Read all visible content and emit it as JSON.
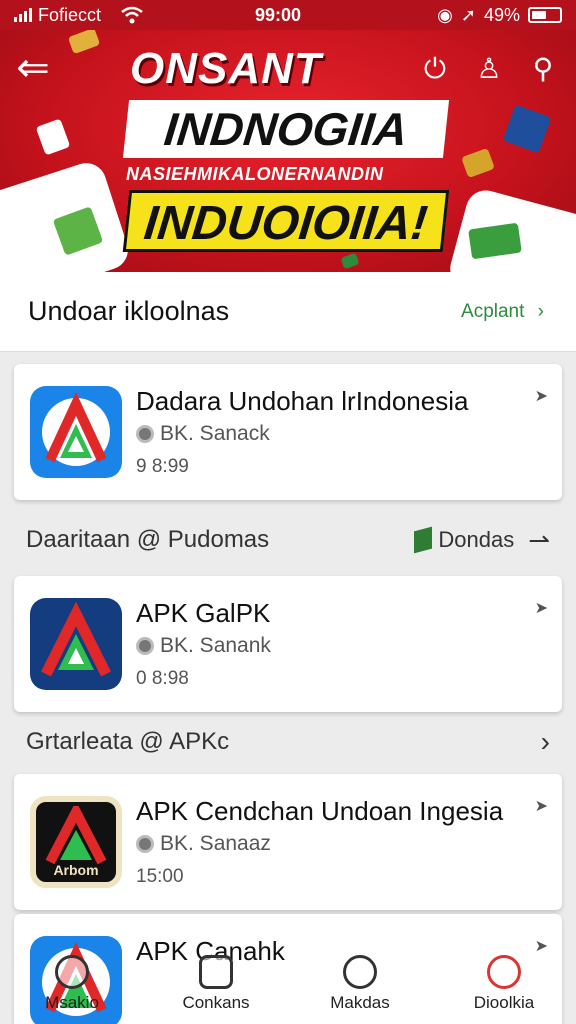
{
  "status_bar": {
    "carrier": "Fofiecct",
    "time": "99:00",
    "battery": "49%"
  },
  "banner": {
    "title": "ONSANT",
    "heading": "INDNOGIIA",
    "subtitle": "NASIEHMIKALONERNANDIN",
    "highlight": "INDUOIOIIA!"
  },
  "section": {
    "title": "Undoar ikloolnas",
    "link": "Acplant",
    "link_icon": "chevron-right-icon"
  },
  "cards": [
    {
      "name": "Dadara Undohan lrIndonesia",
      "developer": "BK. Sanack",
      "size": "9 8:99"
    },
    {
      "name": "APK GalPK",
      "developer": "BK. Sanank",
      "size": "0 8:98"
    },
    {
      "name": "APK Cendchan Undoan Ingesia",
      "developer": "BK. Sanaaz",
      "size": "15:00",
      "icon_label": "Arbom"
    },
    {
      "name": "APK Canahk"
    }
  ],
  "sub_headers": [
    {
      "title": "Daaritaan @ Pudomas",
      "link": "Dondas"
    },
    {
      "title": "Grtarleata @ APKc"
    }
  ],
  "bottom_nav": [
    {
      "label": "Msakio",
      "icon": "search-icon"
    },
    {
      "label": "Conkans",
      "icon": "downloads-icon"
    },
    {
      "label": "Makdas",
      "icon": "library-icon"
    },
    {
      "label": "Dioolkia",
      "icon": "profile-icon"
    }
  ],
  "colors": {
    "brand_red": "#c4121c",
    "accent_green": "#2e8b3d",
    "banner_yellow": "#f5e21a"
  }
}
